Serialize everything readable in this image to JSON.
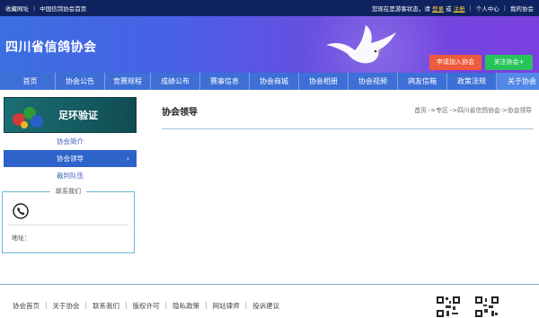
{
  "topbar": {
    "favorites": "收藏网址",
    "home_link": "中国信鸽协会首页",
    "status_prefix": "您现在是游客状态，请",
    "login": "登录",
    "or": "或",
    "register": "注册",
    "personal_center": "个人中心",
    "my_association": "我的协会"
  },
  "banner": {
    "title": "四川省信鸽协会",
    "join_button": "申请加入协会",
    "follow_button": "关注协会+"
  },
  "nav": {
    "items": [
      {
        "label": "首页"
      },
      {
        "label": "协会公告"
      },
      {
        "label": "竞赛规程"
      },
      {
        "label": "成绩公布"
      },
      {
        "label": "赛事信息"
      },
      {
        "label": "协会商城"
      },
      {
        "label": "协会相册"
      },
      {
        "label": "协会视频"
      },
      {
        "label": "鸽友信箱"
      },
      {
        "label": "政策法规"
      },
      {
        "label": "关于协会"
      }
    ],
    "active_index": 10
  },
  "sidebar": {
    "promo_text": "足环验证",
    "menu": [
      {
        "label": "协会简介"
      },
      {
        "label": "协会领导"
      },
      {
        "label": "裁判队伍"
      }
    ],
    "active_index": 1,
    "contact": {
      "title": "联系我们",
      "address_label": "地址："
    }
  },
  "main": {
    "title": "协会领导",
    "breadcrumb": "首页 ->专区 ->四川省信鸽协会->协会领导"
  },
  "footer": {
    "links": [
      "协会首页",
      "关于协会",
      "联系我们",
      "版权许可",
      "隐私政策",
      "网站律师",
      "投诉建议"
    ]
  }
}
